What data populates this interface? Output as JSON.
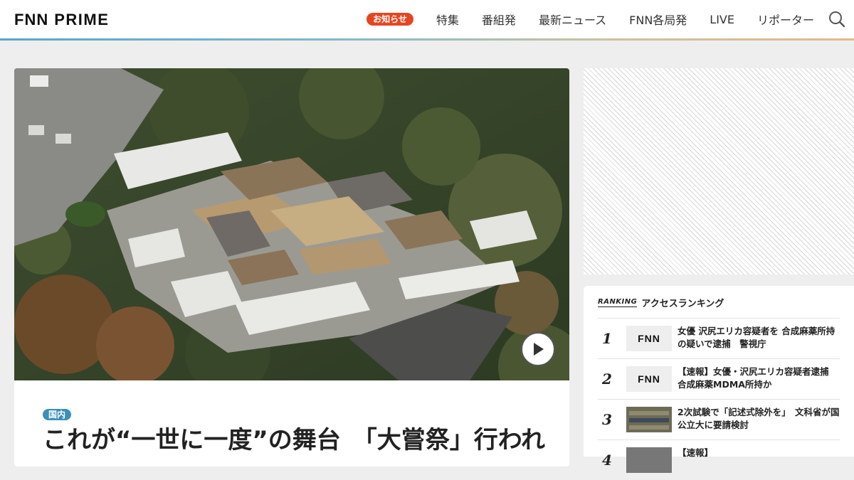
{
  "header": {
    "logo_fnn": "FNN",
    "logo_prime": "PRIME",
    "notice_badge": "お知らせ",
    "nav": [
      "特集",
      "番組発",
      "最新ニュース",
      "FNN各局発",
      "LIVE",
      "リポーター"
    ]
  },
  "article": {
    "category": "国内",
    "headline": "これが“一世に一度”の舞台　「大嘗祭」行われ"
  },
  "ranking": {
    "tag": "RANKING",
    "title": "アクセスランキング",
    "items": [
      {
        "rank": "1",
        "thumb_text": "FNN",
        "title": "女優 沢尻エリカ容疑者を 合成麻薬所持の疑いで逮捕　警視庁"
      },
      {
        "rank": "2",
        "thumb_text": "FNN",
        "title": "【速報】女優・沢尻エリカ容疑者逮捕　合成麻薬MDMA所持か"
      },
      {
        "rank": "3",
        "thumb_text": "",
        "title": "2次試験で「記述式除外を」　文科省が国公立大に要請検討"
      },
      {
        "rank": "4",
        "thumb_text": "",
        "title": "【速報】　　　　　　　　　　"
      }
    ]
  },
  "colors": {
    "accent_badge": "#e6461f",
    "category_badge": "#3a90b6",
    "logo_bar_red": "#e6461f",
    "logo_bar_blue": "#2a7bbf",
    "logo_bar_green": "#4aa84a"
  }
}
